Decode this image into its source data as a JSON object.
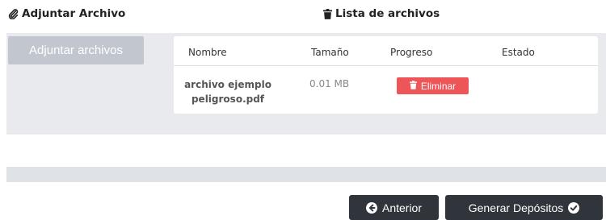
{
  "attach_section": {
    "title": "Adjuntar Archivo",
    "icon": "paperclip-icon"
  },
  "files_section": {
    "title": "Lista de archivos",
    "icon": "trash-icon"
  },
  "upload_button": {
    "label": "Adjuntar archivos"
  },
  "table": {
    "columns": [
      "Nombre",
      "Tamaño",
      "Progreso",
      "Estado"
    ],
    "rows": [
      {
        "name": "archivo ejemplo peligroso.pdf",
        "size": "0.01 MB",
        "action_label": "Eliminar",
        "status": ""
      }
    ]
  },
  "footer": {
    "prev_label": "Anterior",
    "next_label": "Generar Depósitos"
  },
  "colors": {
    "panel_bg": "#e9eaee",
    "upload_button_bg": "#c2c7cf",
    "delete_button_bg": "#ee5558",
    "nav_button_bg": "#2f353b"
  }
}
